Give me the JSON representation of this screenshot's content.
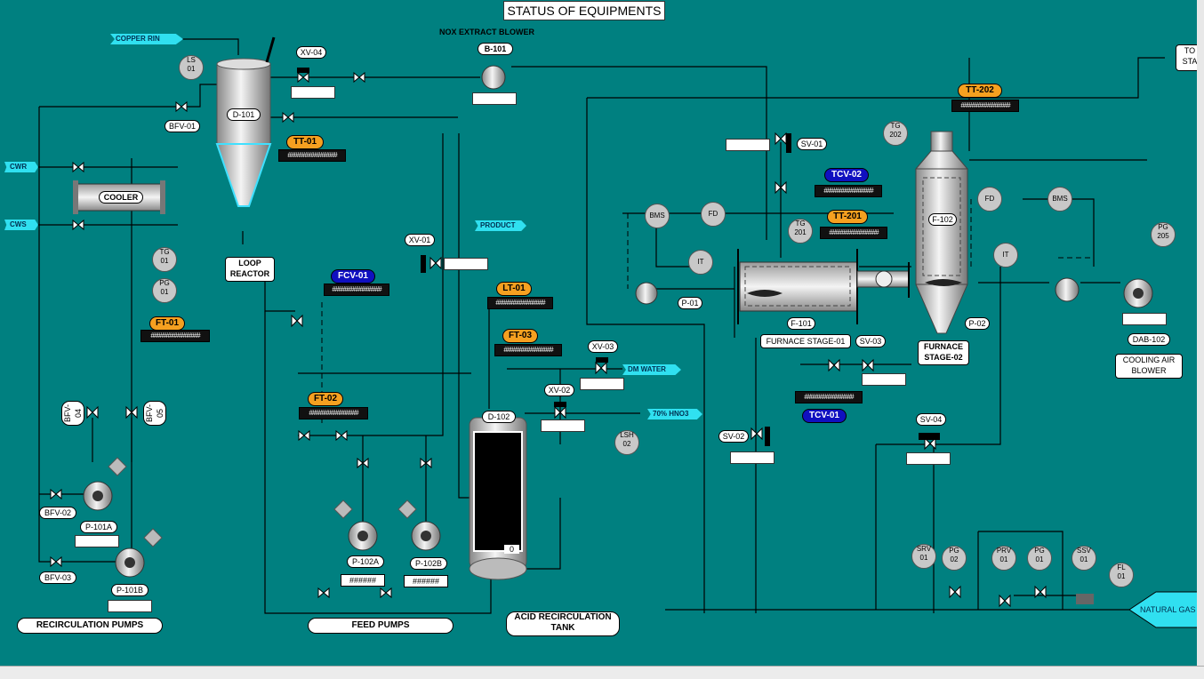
{
  "title": "STATUS OF EQUIPMENTS",
  "streams": {
    "copper": "COPPER RIN",
    "cwr": "CWR",
    "cws": "CWS",
    "product": "PRODUCT",
    "dm_water": "DM WATER",
    "hno3": "70% HNO3",
    "natural_gas": "NATURAL GAS",
    "to_stack": "TO STA"
  },
  "equipment": {
    "d101": "D-101",
    "cooler": "COOLER",
    "loop_reactor": "LOOP REACTOR",
    "nox_blower_title": "NOX EXTRACT BLOWER",
    "b101": "B-101",
    "d102": "D-102",
    "f101": "F-101",
    "furnace1": "FURNACE STAGE-01",
    "f102": "F-102",
    "furnace2": "FURNACE STAGE-02",
    "dab102": "DAB-102",
    "cooling_air": "COOLING AIR BLOWER",
    "p101a": "P-101A",
    "p101b": "P-101B",
    "p102a": "P-102A",
    "p102b": "P-102B",
    "p01": "P-01",
    "p02": "P-02"
  },
  "valves": {
    "xv04": "XV-04",
    "xv01": "XV-01",
    "xv02": "XV-02",
    "xv03": "XV-03",
    "bfv01": "BFV-01",
    "bfv02": "BFV-02",
    "bfv03": "BFV-03",
    "bfv04": "BFV-04",
    "bfv05": "BFV-05",
    "sv01": "SV-01",
    "sv02": "SV-02",
    "sv03": "SV-03",
    "sv04": "SV-04"
  },
  "tags": {
    "tt01": "TT-01",
    "ft01": "FT-01",
    "fcv01": "FCV-01",
    "ft02": "FT-02",
    "lt01": "LT-01",
    "ft03": "FT-03",
    "tcv02": "TCV-02",
    "tt201": "TT-201",
    "tt202": "TT-202",
    "tcv01": "TCV-01"
  },
  "instruments": {
    "ls01": [
      "LS",
      "01"
    ],
    "tg01": [
      "TG",
      "01"
    ],
    "pg01": [
      "PG",
      "01"
    ],
    "lsh02": [
      "LSH",
      "02"
    ],
    "tg201": [
      "TG",
      "201"
    ],
    "tg202": [
      "TG",
      "202"
    ],
    "pg205": [
      "PG",
      "205"
    ],
    "srv01": [
      "SRV",
      "01"
    ],
    "pg02": [
      "PG",
      "02"
    ],
    "prv01": [
      "PRV",
      "01"
    ],
    "pg01b": [
      "PG",
      "01"
    ],
    "ssv01": [
      "SSV",
      "01"
    ],
    "fl01": [
      "FL",
      "01"
    ],
    "bms1": "BMS",
    "bms2": "BMS",
    "fd1": "FD",
    "fd2": "FD",
    "it1": "IT",
    "it2": "IT"
  },
  "readouts": {
    "bar": "################",
    "hash": "######",
    "level": "0"
  },
  "sections": {
    "recirc": "RECIRCULATION PUMPS",
    "feed": "FEED PUMPS",
    "acid": "ACID RECIRCULATION TANK"
  },
  "colors": {
    "background": "#008080",
    "tag_orange": "#f5a020",
    "tag_blue": "#1010c0",
    "stream": "#30e0f0"
  }
}
